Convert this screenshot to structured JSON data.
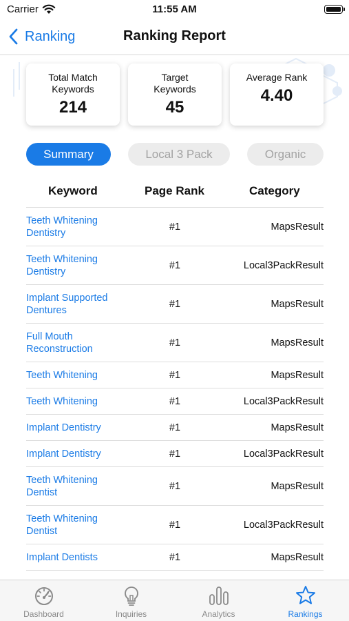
{
  "status": {
    "carrier": "Carrier",
    "time": "11:55 AM"
  },
  "nav": {
    "back_label": "Ranking",
    "title": "Ranking Report"
  },
  "stats": [
    {
      "label": "Total Match Keywords",
      "value": "214"
    },
    {
      "label": "Target Keywords",
      "value": "45"
    },
    {
      "label": "Average Rank",
      "value": "4.40"
    }
  ],
  "tabs": [
    {
      "label": "Summary",
      "active": true
    },
    {
      "label": "Local 3 Pack",
      "active": false
    },
    {
      "label": "Organic",
      "active": false
    }
  ],
  "table": {
    "headers": [
      "Keyword",
      "Page Rank",
      "Category"
    ],
    "rows": [
      {
        "keyword": "Teeth Whitening Dentistry",
        "rank": "#1",
        "category": "MapsResult"
      },
      {
        "keyword": "Teeth Whitening Dentistry",
        "rank": "#1",
        "category": "Local3PackResult"
      },
      {
        "keyword": "Implant Supported Dentures",
        "rank": "#1",
        "category": "MapsResult"
      },
      {
        "keyword": "Full Mouth Reconstruction",
        "rank": "#1",
        "category": "MapsResult"
      },
      {
        "keyword": "Teeth Whitening",
        "rank": "#1",
        "category": "MapsResult"
      },
      {
        "keyword": "Teeth Whitening",
        "rank": "#1",
        "category": "Local3PackResult"
      },
      {
        "keyword": "Implant Dentistry",
        "rank": "#1",
        "category": "MapsResult"
      },
      {
        "keyword": "Implant Dentistry",
        "rank": "#1",
        "category": "Local3PackResult"
      },
      {
        "keyword": "Teeth Whitening Dentist",
        "rank": "#1",
        "category": "MapsResult"
      },
      {
        "keyword": "Teeth Whitening Dentist",
        "rank": "#1",
        "category": "Local3PackResult"
      },
      {
        "keyword": "Implant Dentists",
        "rank": "#1",
        "category": "MapsResult"
      }
    ]
  },
  "tab_bar": {
    "items": [
      {
        "label": "Dashboard",
        "icon": "gauge-icon",
        "selected": false
      },
      {
        "label": "Inquiries",
        "icon": "lightbulb-icon",
        "selected": false
      },
      {
        "label": "Analytics",
        "icon": "bars-icon",
        "selected": false
      },
      {
        "label": "Rankings",
        "icon": "star-icon",
        "selected": true
      }
    ]
  },
  "colors": {
    "accent": "#1a7be6",
    "inactive_tab_bg": "#ececec",
    "inactive_text": "#a2a2a2"
  }
}
